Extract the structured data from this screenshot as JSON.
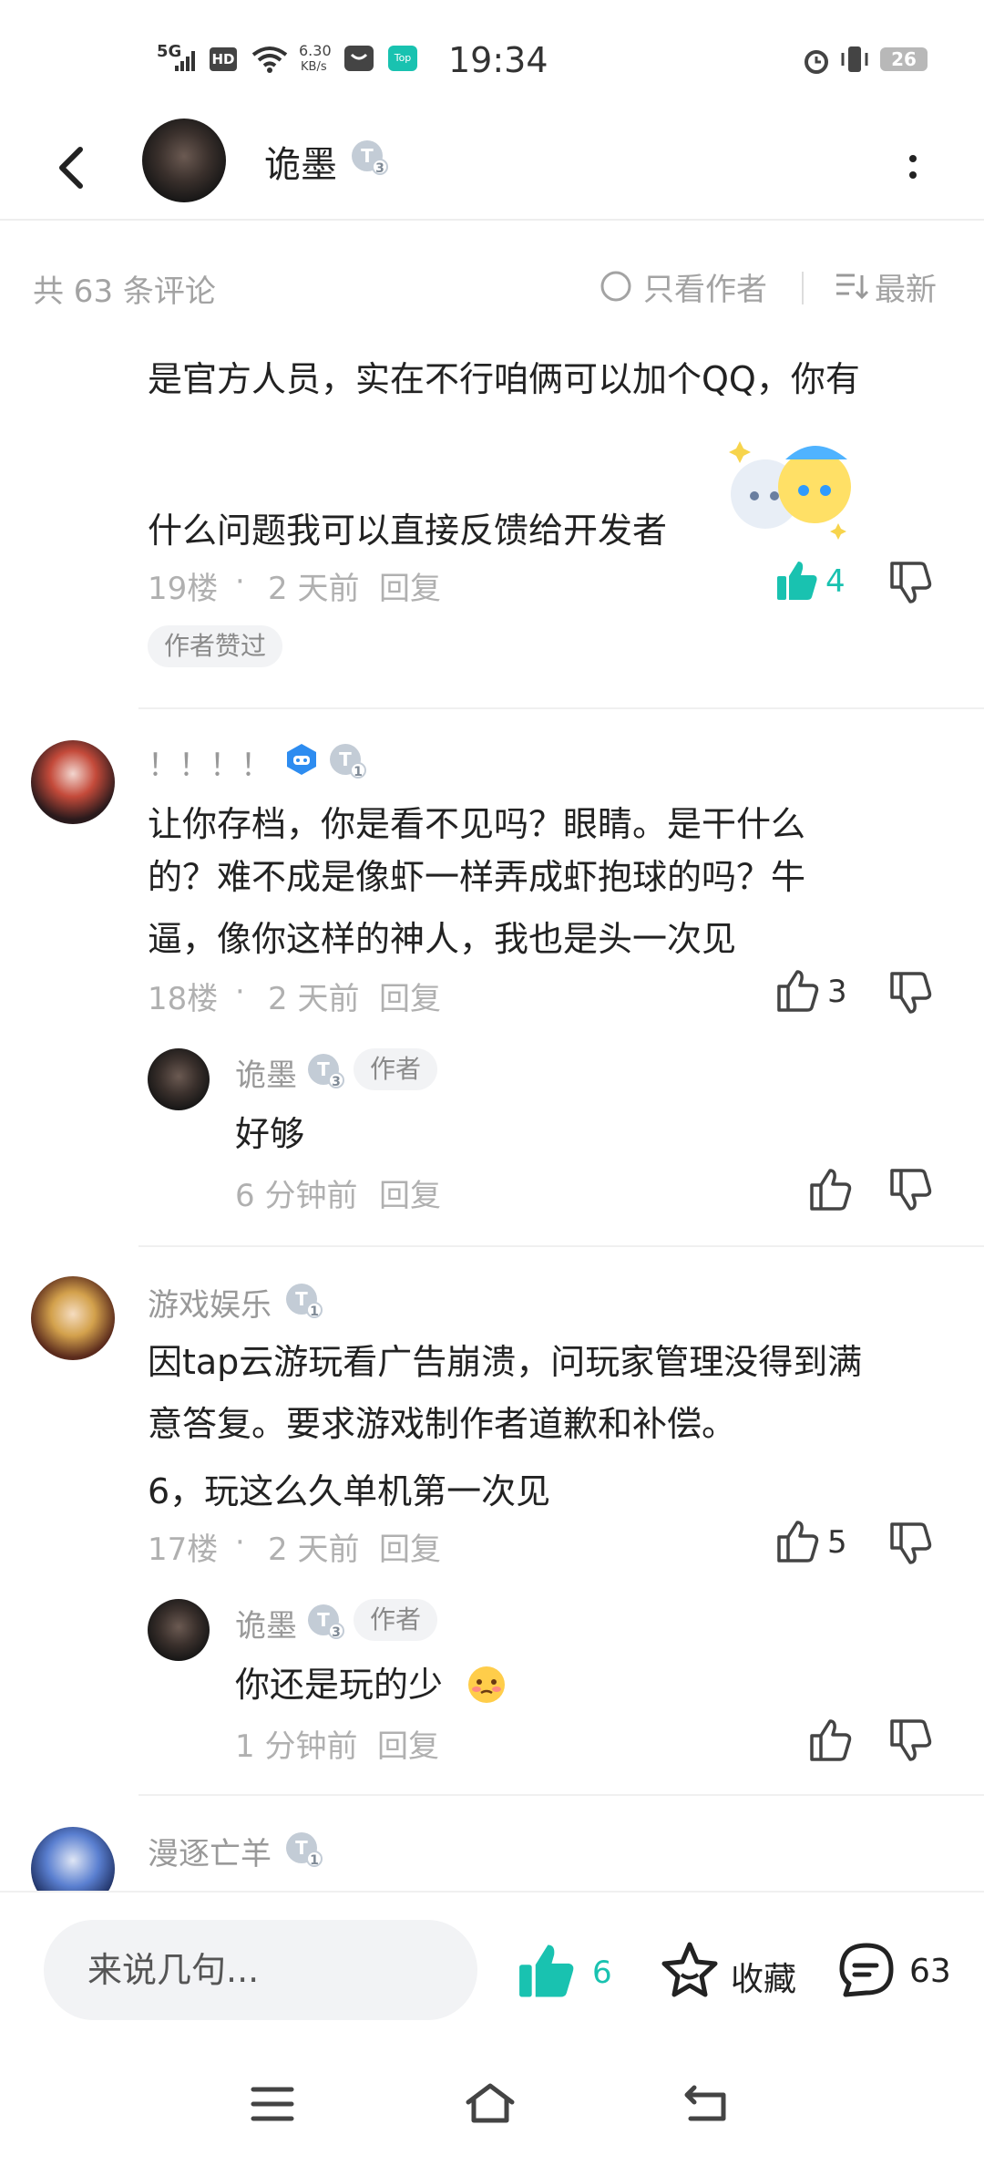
{
  "status_bar": {
    "network": "5G",
    "hd": "HD",
    "speed_value": "6.30",
    "speed_unit": "KB/s",
    "top_label": "Top",
    "time": "19:34",
    "battery": "26"
  },
  "app_bar": {
    "author_name": "诡墨",
    "level": "3"
  },
  "comments_header": {
    "total": "共 63 条评论",
    "only_author": "只看作者",
    "sort": "最新"
  },
  "comments": [
    {
      "lines": [
        "是官方人员，实在不行咱俩可以加个QQ，你有",
        "什么问题我可以直接反馈给开发者"
      ],
      "floor": "19楼",
      "time": "2 天前",
      "reply_label": "回复",
      "likes": "4",
      "liked": true,
      "badge": "作者赞过"
    },
    {
      "user": "！！！！",
      "level": "1",
      "lines": [
        "让你存档，你是看不见吗？眼睛。是干什么",
        "的？难不成是像虾一样弄成虾抱球的吗？牛",
        "逼，像你这样的神人，我也是头一次见"
      ],
      "floor": "18楼",
      "time": "2 天前",
      "reply_label": "回复",
      "likes": "3",
      "reply": {
        "user": "诡墨",
        "level": "3",
        "author_tag": "作者",
        "text": "好够",
        "time": "6 分钟前",
        "reply_label": "回复"
      }
    },
    {
      "user": "游戏娱乐",
      "level": "1",
      "lines": [
        "因tap云游玩看广告崩溃，问玩家管理没得到满",
        "意答复。要求游戏制作者道歉和补偿。",
        "6，玩这么久单机第一次见"
      ],
      "floor": "17楼",
      "time": "2 天前",
      "reply_label": "回复",
      "likes": "5",
      "reply": {
        "user": "诡墨",
        "level": "3",
        "author_tag": "作者",
        "text": "你还是玩的少",
        "time": "1 分钟前",
        "reply_label": "回复"
      }
    },
    {
      "user": "漫逐亡羊",
      "level": "1"
    }
  ],
  "bottom_bar": {
    "input_placeholder": "来说几句...",
    "likes": "6",
    "favorite_label": "收藏",
    "comments_count": "63"
  },
  "colors": {
    "accent": "#19c2b0",
    "muted": "#a3a3a3",
    "divider": "#f0f0f0"
  }
}
